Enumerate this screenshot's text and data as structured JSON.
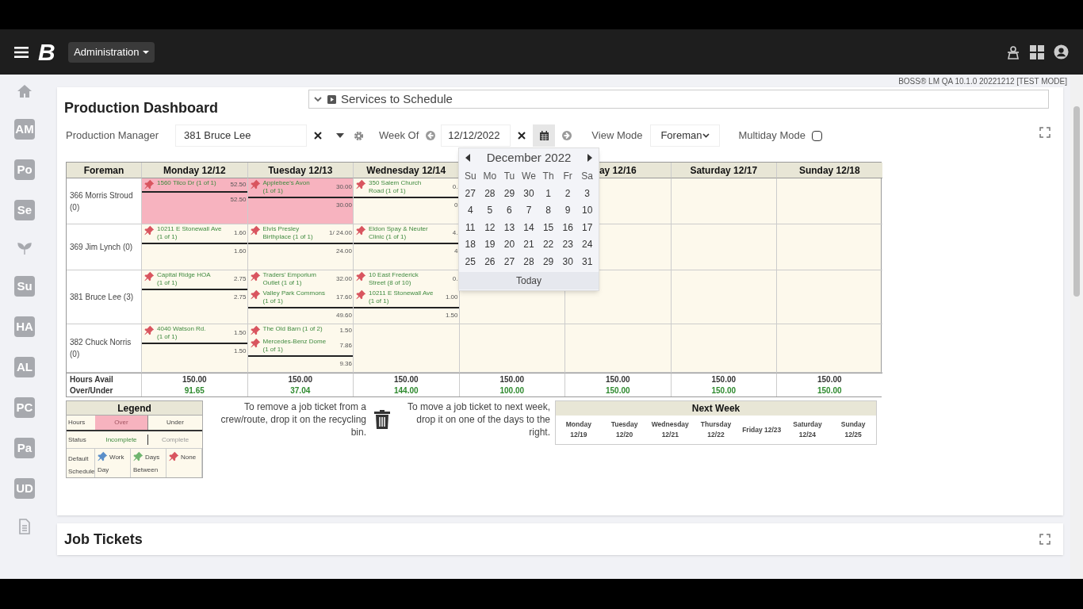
{
  "header": {
    "logo": "B",
    "menu": "Administration",
    "version": "BOSS® LM QA 10.1.0 20221212 [TEST MODE]"
  },
  "sidebar": [
    {
      "kind": "icon"
    },
    {
      "kind": "tile",
      "label": "AM"
    },
    {
      "kind": "tile",
      "label": "Po"
    },
    {
      "kind": "tile",
      "label": "Se"
    },
    {
      "kind": "icon"
    },
    {
      "kind": "tile",
      "label": "Su"
    },
    {
      "kind": "tile",
      "label": "HA"
    },
    {
      "kind": "tile",
      "label": "AL"
    },
    {
      "kind": "tile",
      "label": "PC"
    },
    {
      "kind": "tile",
      "label": "Pa"
    },
    {
      "kind": "tile",
      "label": "UD"
    },
    {
      "kind": "icon"
    }
  ],
  "title": "Production Dashboard",
  "services_panel": {
    "title": "Services to Schedule",
    "expanded": false
  },
  "filters": {
    "manager_label": "Production Manager",
    "manager": "381 Bruce Lee",
    "week_label": "Week Of",
    "week": "12/12/2022",
    "view_label": "View Mode",
    "view": "Foreman",
    "multiday_label": "Multiday Mode",
    "multiday": false
  },
  "columns": [
    {
      "label": "Foreman"
    },
    {
      "label": "Monday 12/12"
    },
    {
      "label": "Tuesday 12/13"
    },
    {
      "label": "Wednesday 12/14"
    },
    {},
    {
      "label": "ay 12/16"
    },
    {
      "label": "Saturday 12/17"
    },
    {
      "label": "Sunday 12/18"
    }
  ],
  "rows": [
    {
      "foreman": "366 Morris Stroud (0)",
      "cells": [
        {
          "over": true,
          "tickets": [
            {
              "name": "1560 Tilco Dr",
              "count": "(1 of 1)",
              "hours": "52.50",
              "complete": false
            }
          ],
          "total": "52.50"
        },
        {
          "over": true,
          "tickets": [
            {
              "name": "Applebee's Avon",
              "count": "(1 of 1)",
              "hours": "30.00",
              "complete": false
            }
          ],
          "total": "30.00"
        },
        {
          "over": false,
          "tickets": [
            {
              "name": "350 Salem Church Road",
              "count": "(1 of 1)",
              "hours": "0.",
              "complete": false
            }
          ],
          "total": "0"
        },
        {},
        {},
        {},
        {}
      ]
    },
    {
      "foreman": "369 Jim Lynch (0)",
      "cells": [
        {
          "over": false,
          "tickets": [
            {
              "name": "10211 E Stonewall Ave",
              "count": "(1 of 1)",
              "hours": "1.60",
              "complete": false
            }
          ],
          "total": "1.60"
        },
        {
          "over": false,
          "tickets": [
            {
              "name": "Elvis Presley Birthplace",
              "count": "(1 of 1)",
              "hours": "1/ 24.00",
              "complete": false
            }
          ],
          "total": "24.00"
        },
        {
          "over": false,
          "tickets": [
            {
              "name": "Eldon Spay & Neuter Clinic",
              "count": "(1 of 1)",
              "hours": "4.",
              "complete": false
            }
          ],
          "total": "4"
        },
        {},
        {},
        {},
        {}
      ]
    },
    {
      "foreman": "381 Bruce Lee (3)",
      "cells": [
        {
          "over": false,
          "tickets": [
            {
              "name": "Capital Ridge HOA",
              "count": "(1 of 1)",
              "hours": "2.75",
              "complete": false
            }
          ],
          "total": "2.75"
        },
        {
          "over": false,
          "tickets": [
            {
              "name": "Traders' Emporium Outlet",
              "count": "(1 of 1)",
              "hours": "32.00",
              "complete": false
            },
            {
              "name": "Valley Park Commons",
              "count": "(1 of 1)",
              "hours": "17.60",
              "complete": false
            }
          ],
          "total": "49.60"
        },
        {
          "over": false,
          "tickets": [
            {
              "name": "10 East Frederick Street",
              "count": "(8 of 10)",
              "hours": "0.",
              "complete": false
            },
            {
              "name": "10211 E Stonewall Ave",
              "count": "(1 of 1)",
              "hours": "1.00",
              "complete": false
            }
          ],
          "total": "1.50"
        },
        {},
        {},
        {},
        {}
      ]
    },
    {
      "foreman": "382 Chuck Norris (0)",
      "cells": [
        {
          "over": false,
          "tickets": [
            {
              "name": "4040 Watson Rd.",
              "count": "(1 of 1)",
              "hours": "1.50",
              "complete": false
            }
          ],
          "total": "1.50"
        },
        {
          "over": false,
          "tickets": [
            {
              "name": "The Old Barn",
              "count": "(1 of 2)",
              "hours": "1.50",
              "complete": false
            },
            {
              "name": "Mercedes-Benz Dome",
              "count": "(1 of 1)",
              "hours": "7.86",
              "complete": false
            }
          ],
          "total": "9.36"
        },
        {},
        {},
        {},
        {},
        {}
      ]
    }
  ],
  "totals": [
    {
      "label": "Hours Avail",
      "values": [
        "150.00",
        "150.00",
        "150.00",
        "150.00",
        "150.00",
        "150.00",
        "150.00"
      ]
    },
    {
      "label": "Over/Under",
      "values": [
        "91.65",
        "37.04",
        "144.00",
        "100.00",
        "150.00",
        "150.00",
        "150.00"
      ]
    }
  ],
  "datepicker": {
    "month": "December 2022",
    "weekdays": [
      "Su",
      "Mo",
      "Tu",
      "We",
      "Th",
      "Fr",
      "Sa"
    ],
    "weeks": [
      [
        "27",
        "28",
        "29",
        "30",
        "1",
        "2",
        "3"
      ],
      [
        "4",
        "5",
        "6",
        "7",
        "8",
        "9",
        "10"
      ],
      [
        "11",
        "12",
        "13",
        "14",
        "15",
        "16",
        "17"
      ],
      [
        "18",
        "19",
        "20",
        "21",
        "22",
        "23",
        "24"
      ],
      [
        "25",
        "26",
        "27",
        "28",
        "29",
        "30",
        "31"
      ]
    ],
    "today": "Today"
  },
  "legend": {
    "title": "Legend",
    "hours_label": "Hours",
    "over": "Over",
    "under": "Under",
    "status_label": "Status",
    "incomplete": "Incomplete",
    "complete": "Complete",
    "schedule_label": "Default Schedule",
    "schedules": [
      {
        "label": "Work Day",
        "color": "#5b8fc9"
      },
      {
        "label": "Days Between",
        "color": "#6fb56f"
      },
      {
        "label": "None",
        "color": "#d9555f"
      }
    ]
  },
  "remove_hint": "To remove a job ticket from a crew/route, drop it on the recycling bin.",
  "move_hint": "To move a job ticket to next week, drop it on one of the days to the right.",
  "next_week": {
    "title": "Next Week",
    "days": [
      "Monday 12/19",
      "Tuesday 12/20",
      "Wednesday 12/21",
      "Thursday 12/22",
      "Friday 12/23",
      "Saturday 12/24",
      "Sunday 12/25"
    ]
  },
  "job_tickets": {
    "title": "Job Tickets"
  }
}
